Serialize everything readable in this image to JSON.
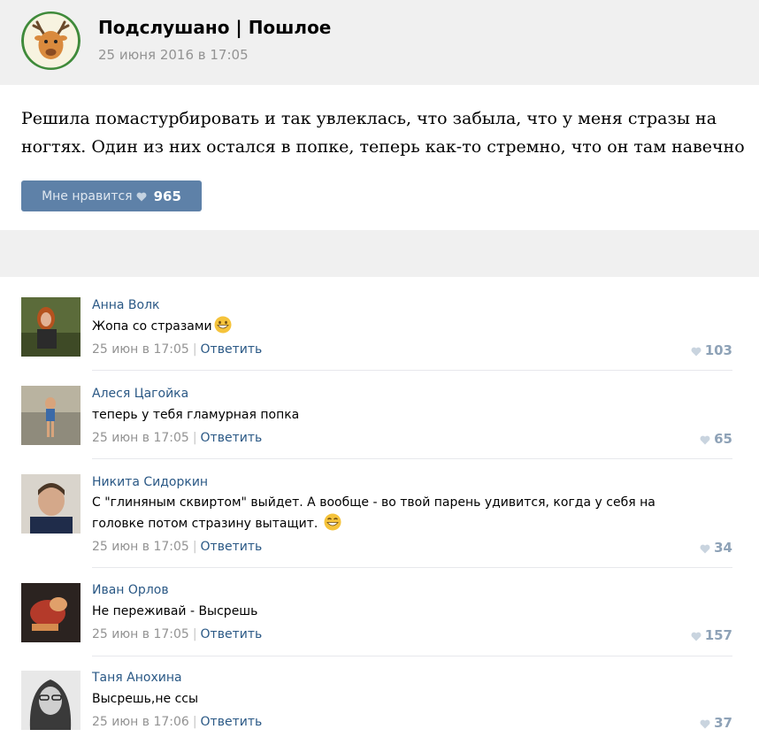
{
  "post": {
    "group_title": "Подслушано | Пошлое",
    "date": "25 июня 2016 в 17:05",
    "text": "Решила помастурбировать и так увлеклась, что забыла, что у меня стразы на ногтях. Один из них остался в попке, теперь как-то стремно, что он там навечно",
    "like_label": "Мне нравится",
    "like_count": "965"
  },
  "comments": [
    {
      "author": "Анна Волк",
      "text": "Жопа со стразами",
      "time": "25 июн в 17:05",
      "reply": "Ответить",
      "likes": "103"
    },
    {
      "author": "Алеся Цагойка",
      "text": "теперь у тебя гламурная попка",
      "time": "25 июн в 17:05",
      "reply": "Ответить",
      "likes": "65"
    },
    {
      "author": "Никита Сидоркин",
      "text": "С \"глиняным сквиртом\" выйдет. А вообще - во твой парень удивится, когда у себя на головке потом стразину вытащит.",
      "time": "25 июн в 17:05",
      "reply": "Ответить",
      "likes": "34"
    },
    {
      "author": "Иван Орлов",
      "text": "Не переживай - Высрешь",
      "time": "25 июн в 17:05",
      "reply": "Ответить",
      "likes": "157"
    },
    {
      "author": "Таня Анохина",
      "text": "Высрешь,не ссы",
      "time": "25 июн в 17:06",
      "reply": "Ответить",
      "likes": "37"
    }
  ],
  "colors": {
    "accent": "#5e81a8",
    "link": "#2a5885",
    "muted": "#939393",
    "header_bg": "#f0f0f0"
  }
}
